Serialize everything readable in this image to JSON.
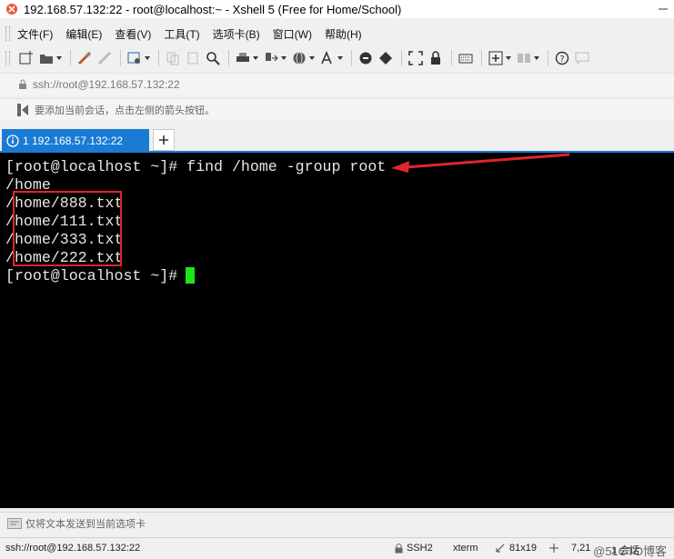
{
  "window": {
    "title": "192.168.57.132:22 - root@localhost:~ - Xshell 5 (Free for Home/School)",
    "accent_color": "#1a7bd4"
  },
  "menu": {
    "items": [
      "文件(F)",
      "编辑(E)",
      "查看(V)",
      "工具(T)",
      "选项卡(B)",
      "窗口(W)",
      "帮助(H)"
    ]
  },
  "toolbar": {
    "icons": [
      "new-session-icon",
      "open-folder-icon",
      "connect-icon",
      "disconnect-icon",
      "properties-icon",
      "copy-icon",
      "paste-icon",
      "find-icon",
      "print-icon",
      "transfer-icon",
      "globe-icon",
      "font-icon",
      "xftp-icon",
      "xmanager-icon",
      "fullscreen-icon",
      "lock-icon",
      "keyboard-icon",
      "add-pane-icon",
      "layout-icon",
      "help-icon",
      "comment-icon"
    ]
  },
  "address": {
    "value": "ssh://root@192.168.57.132:22"
  },
  "hint": {
    "text": "要添加当前会话，点击左侧的箭头按钮。"
  },
  "tabs": {
    "active_label": "1 192.168.57.132:22"
  },
  "terminal": {
    "lines": [
      "[root@localhost ~]# find /home -group root",
      "/home",
      "/home/888.txt",
      "/home/111.txt",
      "/home/333.txt",
      "/home/222.txt",
      "[root@localhost ~]# "
    ],
    "cursor_color": "#17e817",
    "annotation_color": "#e0252a"
  },
  "sendbar": {
    "text": "仅将文本发送到当前选项卡"
  },
  "status": {
    "connection": "ssh://root@192.168.57.132:22",
    "protocol": "SSH2",
    "terminal_type": "xterm",
    "size": "81x19",
    "position": "7,21",
    "sessions": "1 会话"
  },
  "watermark": "@51CTO博客"
}
